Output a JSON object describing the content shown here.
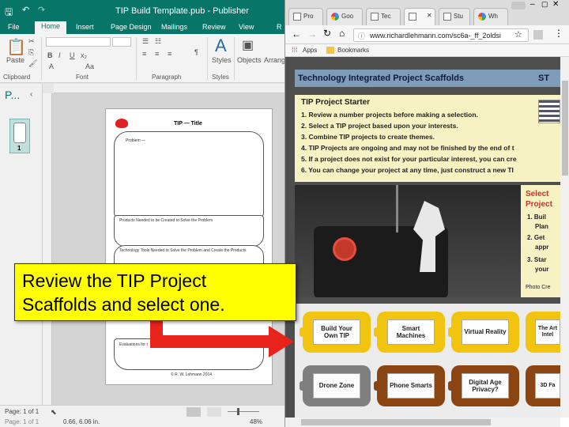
{
  "publisher": {
    "title": "TIP Build Template.pub - Publisher",
    "tabs": [
      "File",
      "Home",
      "Insert",
      "Page Design",
      "Mailings",
      "Review",
      "View",
      "R"
    ],
    "active_tab": "Home",
    "groups": {
      "clipboard": "Clipboard",
      "font": "Font",
      "paragraph": "Paragraph",
      "styles": "Styles"
    },
    "buttons": {
      "paste": "Paste",
      "styles": "Styles",
      "objects": "Objects",
      "arrange": "Arrang"
    },
    "font_buttons": [
      "B",
      "I",
      "U",
      "x₂",
      "A",
      "Aa"
    ],
    "nav_title": "P...",
    "page_number": "1",
    "document": {
      "title": "TIP   — Title",
      "problem": "Problem —",
      "products": "Products Needed to be Created to Solve the Problem",
      "tools": "Technology Tools Needed to Solve the Problem and Create the Products",
      "evaluations": "Evaluations for t",
      "copyright": "© R. W. Lehmann 2014"
    },
    "status": {
      "page": "Page: 1 of 1",
      "position": "0.66, 6.06 in.",
      "zoom": "48%"
    }
  },
  "chrome": {
    "tabs": [
      {
        "label": "Pro",
        "favicon": "doc-icon"
      },
      {
        "label": "Goo",
        "favicon": "google-icon"
      },
      {
        "label": "Tec",
        "favicon": "doc-icon"
      },
      {
        "label": "",
        "favicon": "doc-icon",
        "active": true
      },
      {
        "label": "Stu",
        "favicon": "doc-icon"
      },
      {
        "label": "Wh",
        "favicon": "google-icon"
      }
    ],
    "url": "www.richardlehmann.com/sc6a-_ff_2oldsi",
    "bookmarks": {
      "apps": "Apps",
      "bookmarks": "Bookmarks"
    }
  },
  "site": {
    "header": "Technology Integrated Project Scaffolds",
    "header_right": "ST",
    "starter_title": "TIP Project Starter",
    "starter_steps": [
      "1. Review a number projects before making a selection.",
      "2. Select a TIP project based upon your interests.",
      "3. Combine TIP projects to create themes.",
      "4. TIP Projects are ongoing and may not be finished by the end of t",
      "5. If a project does not exist for your particular interest, you can cre",
      "6. You can change your project at any time, just construct a new TI"
    ],
    "side": {
      "title1": "Select",
      "title2": "Project",
      "items": [
        "1. Buil",
        "Plan",
        "2. Get",
        "appr",
        "3. Star",
        "your"
      ],
      "credit": "Photo Cre"
    },
    "tiles": [
      {
        "label": "Build Your Own TIP",
        "color": "#f1c40f"
      },
      {
        "label": "Smart Machines",
        "color": "#f1c40f"
      },
      {
        "label": "Virtual Reality",
        "color": "#f1c40f"
      },
      {
        "label": "The Art Intel",
        "color": "#f1c40f"
      },
      {
        "label": "Drone Zone",
        "color": "#7f7f7f"
      },
      {
        "label": "Phone Smarts",
        "color": "#8b4513"
      },
      {
        "label": "Digital Age Privacy?",
        "color": "#8b4513"
      },
      {
        "label": "3D Fa",
        "color": "#8b4513"
      }
    ]
  },
  "callout": {
    "line1": "Review the TIP Project",
    "line2": "Scaffolds and select one."
  },
  "colors": {
    "publisher_green": "#077568",
    "arrow": "#e8231b",
    "callout_bg": "#ffff00"
  }
}
